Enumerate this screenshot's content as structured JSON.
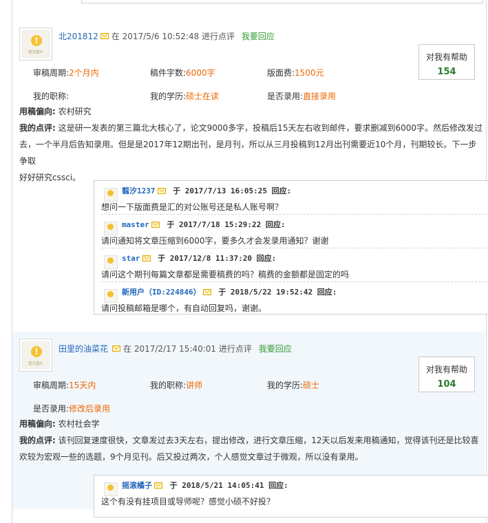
{
  "review1": {
    "user": "北201812",
    "time": "在 2017/5/6 10:52:48 进行点评",
    "reply_link": "我要回应",
    "helpful_label": "对我有帮助",
    "helpful_count": "154",
    "cycle_label": "审稿周期:",
    "cycle_value": "2个月内",
    "words_label": "稿件字数:",
    "words_value": "6000字",
    "fee_label": "版面费:",
    "fee_value": "1500元",
    "title_label": "我的职称:",
    "title_value": "",
    "edu_label": "我的学历:",
    "edu_value": "硕士在读",
    "accept_label": "是否录用:",
    "accept_value": "直接录用",
    "pref_label": "用稿偏向:",
    "pref_value": "农村研究",
    "comment_label": "我的点评:",
    "comment_l1": "这是研一发表的第三篇北大核心了，论文9000多字，投稿后15天左右收到邮件，要求删减到6000字。然后修改发过",
    "comment_l2": "去，一个半月后告知录用。但是是2017年12期出刊，是月刊，所以从三月投稿到12月出刊需要近10个月，刊期较长。下一步争取",
    "comment_l3": "好好研究cssci。",
    "replies": [
      {
        "name": "翦汐1237",
        "mid": "于",
        "time": "2017/7/13 16:05:25",
        "tail": "回应:",
        "text": "想问一下版面费是汇的对公账号还是私人账号啊？"
      },
      {
        "name": "master",
        "mid": "于",
        "time": "2017/7/18 15:29:22",
        "tail": "回应:",
        "text": "请问通知将文章压缩到6000字，要多久才会发录用通知？谢谢"
      },
      {
        "name": "star",
        "mid": "于",
        "time": "2017/12/8 11:37:20",
        "tail": "回应:",
        "text": "请问这个期刊每篇文章都是需要稿费的吗？稿费的金额都是固定的吗"
      },
      {
        "name": "新用户（ID:224846）",
        "mid": "于",
        "time": "2018/5/22 19:52:42",
        "tail": "回应:",
        "text": "请问投稿邮箱是哪个，有自动回复吗，谢谢。"
      }
    ]
  },
  "review2": {
    "user": "田里的油菜花",
    "time": "在 2017/2/17 15:40:01 进行点评",
    "reply_link": "我要回应",
    "helpful_label": "对我有帮助",
    "helpful_count": "104",
    "cycle_label": "审稿周期:",
    "cycle_value": "15天内",
    "title_label": "我的职称:",
    "title_value": "讲师",
    "edu_label": "我的学历:",
    "edu_value": "硕士",
    "accept_label": "是否录用:",
    "accept_value": "修改后录用",
    "pref_label": "用稿偏向:",
    "pref_value": "农村社会学",
    "comment_label": "我的点评:",
    "comment_l1": "该刊回复速度很快，文章发过去3天左右，提出修改，进行文章压缩，12天以后发来用稿通知，觉得该刊还是比较喜",
    "comment_l2": "欢较为宏观一些的选题，9个月见刊。后又投过两次，个人感觉文章过于微观，所以没有录用。",
    "replies": [
      {
        "name": "摇滚橘子",
        "mid": "于",
        "time": "2018/5/21 14:05:41",
        "tail": "回应:",
        "text": "这个有没有挂项目或导师呢？感觉小硕不好投？"
      }
    ]
  },
  "avatar_text": "暂无图片"
}
